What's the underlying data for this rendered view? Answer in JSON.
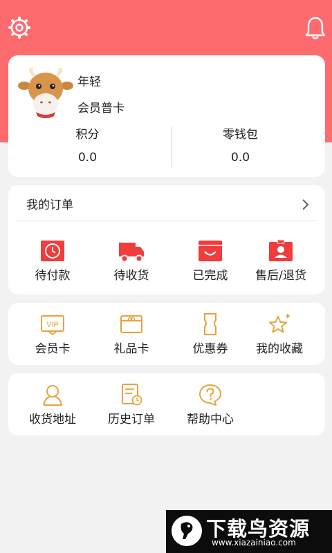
{
  "header": {
    "settings_icon": "gear-icon",
    "notification_icon": "bell-icon",
    "bg_color": "#fe6b6e"
  },
  "profile": {
    "name": "年轻",
    "level": "会员普卡",
    "points_label": "积分",
    "points_value": "0.0",
    "wallet_label": "零钱包",
    "wallet_value": "0.0"
  },
  "orders": {
    "title": "我的订单",
    "items": [
      {
        "label": "待付款",
        "icon": "clock-icon"
      },
      {
        "label": "待收货",
        "icon": "truck-icon"
      },
      {
        "label": "已完成",
        "icon": "smile-icon"
      },
      {
        "label": "售后/退货",
        "icon": "person-badge-icon"
      }
    ]
  },
  "services": {
    "items": [
      {
        "label": "会员卡",
        "icon": "vip-card-icon",
        "badge": "VIP"
      },
      {
        "label": "礼品卡",
        "icon": "gift-card-icon"
      },
      {
        "label": "优惠券",
        "icon": "coupon-icon"
      },
      {
        "label": "我的收藏",
        "icon": "star-icon"
      }
    ]
  },
  "tools": {
    "items": [
      {
        "label": "收货地址",
        "icon": "location-person-icon"
      },
      {
        "label": "历史订单",
        "icon": "history-order-icon"
      },
      {
        "label": "帮助中心",
        "icon": "help-icon"
      }
    ]
  },
  "watermark": {
    "title": "下载鸟资源",
    "url": "www.xiazainiao.com"
  },
  "colors": {
    "accent": "#f03c3c",
    "gold": "#e8a23a",
    "text": "#222222"
  }
}
